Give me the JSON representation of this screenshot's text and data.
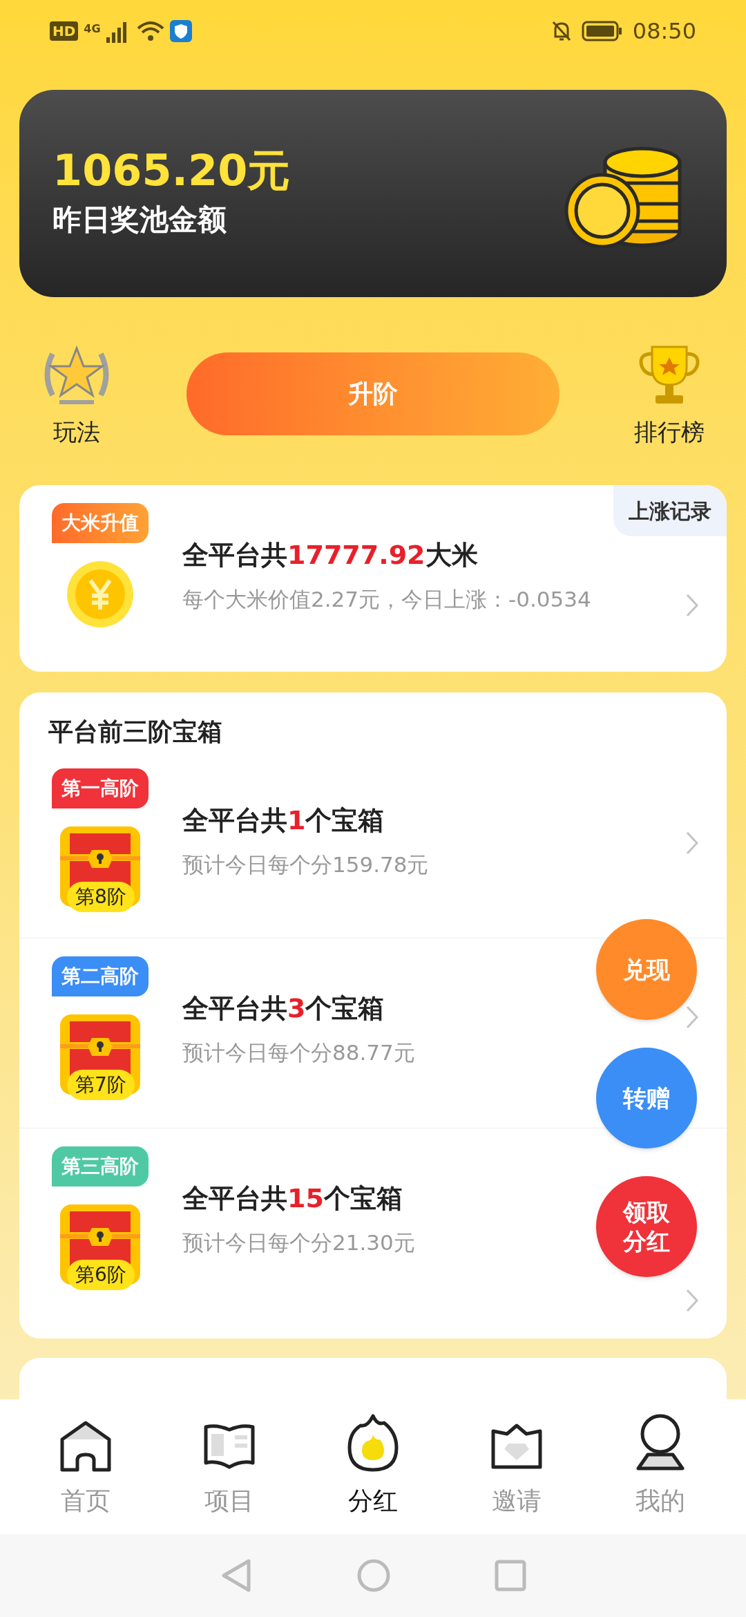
{
  "status_bar": {
    "hd": "HD",
    "network": "4G",
    "time": "08:50"
  },
  "pool_card": {
    "amount": "1065.20元",
    "label": "昨日奖池金额"
  },
  "actions": {
    "left": "玩法",
    "button": "升阶",
    "right": "排行榜"
  },
  "rice_card": {
    "badge": "大米升值",
    "record": "上涨记录",
    "title_before": "全平台共",
    "title_highlight": "17777.92",
    "title_after": "大米",
    "subtitle": "每个大米价值2.27元，今日上涨：-0.0534"
  },
  "chest_card": {
    "title": "平台前三阶宝箱",
    "rows": [
      {
        "badge": "第一高阶",
        "color": "#f0323a",
        "level": "第8阶",
        "title_before": "全平台共",
        "title_highlight": "1",
        "title_after": "个宝箱",
        "subtitle": "预计今日每个分159.78元"
      },
      {
        "badge": "第二高阶",
        "color": "#3b8ef5",
        "level": "第7阶",
        "title_before": "全平台共",
        "title_highlight": "3",
        "title_after": "个宝箱",
        "subtitle": "预计今日每个分88.77元"
      },
      {
        "badge": "第三高阶",
        "color": "#4fc9a3",
        "level": "第6阶",
        "title_before": "全平台共",
        "title_highlight": "15",
        "title_after": "个宝箱",
        "subtitle": "预计今日每个分21.30元"
      }
    ]
  },
  "floating_buttons": [
    {
      "label": "兑现",
      "color": "#ff8a2a"
    },
    {
      "label": "转赠",
      "color": "#3b8ef5"
    },
    {
      "label": "领取分红",
      "color": "#f0323a"
    }
  ],
  "bottom_nav": [
    {
      "label": "首页",
      "selected": false
    },
    {
      "label": "项目",
      "selected": false
    },
    {
      "label": "分红",
      "selected": true
    },
    {
      "label": "邀请",
      "selected": false
    },
    {
      "label": "我的",
      "selected": false
    }
  ]
}
